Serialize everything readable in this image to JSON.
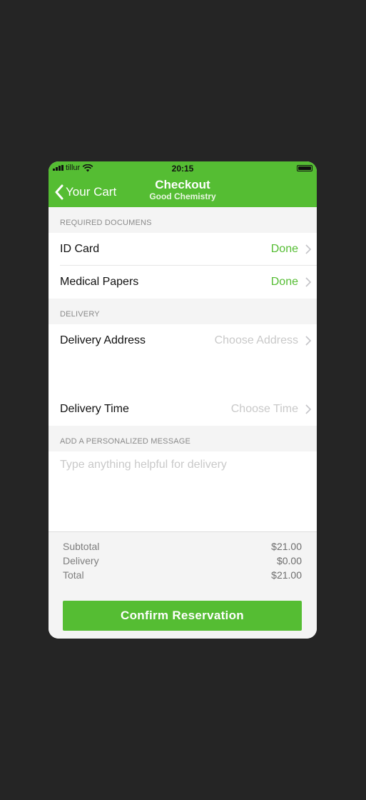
{
  "status_bar": {
    "carrier": "tillur",
    "time": "20:15"
  },
  "nav": {
    "back_label": "Your Cart",
    "title": "Checkout",
    "subtitle": "Good Chemistry"
  },
  "required_documents": {
    "header": "REQUIRED DOCUMENS",
    "items": [
      {
        "label": "ID Card",
        "status": "Done"
      },
      {
        "label": "Medical Papers",
        "status": "Done"
      }
    ]
  },
  "delivery": {
    "header": "DELIVERY",
    "address": {
      "label": "Delivery Address",
      "placeholder": "Choose Address"
    },
    "time": {
      "label": "Delivery Time",
      "placeholder": "Choose Time"
    }
  },
  "message": {
    "header": "ADD A PERSONALIZED MESSAGE",
    "placeholder": "Type anything helpful for delivery",
    "value": ""
  },
  "summary": {
    "subtotal_label": "Subtotal",
    "subtotal": "$21.00",
    "delivery_label": "Delivery",
    "delivery": "$0.00",
    "total_label": "Total",
    "total": "$21.00"
  },
  "confirm_label": "Confirm Reservation",
  "colors": {
    "accent": "#55bd33",
    "background": "#252525",
    "screen": "#f4f4f4"
  },
  "icons": [
    "signal-icon",
    "wifi-icon",
    "battery-icon",
    "back-chevron-icon",
    "chevron-right-icon"
  ]
}
